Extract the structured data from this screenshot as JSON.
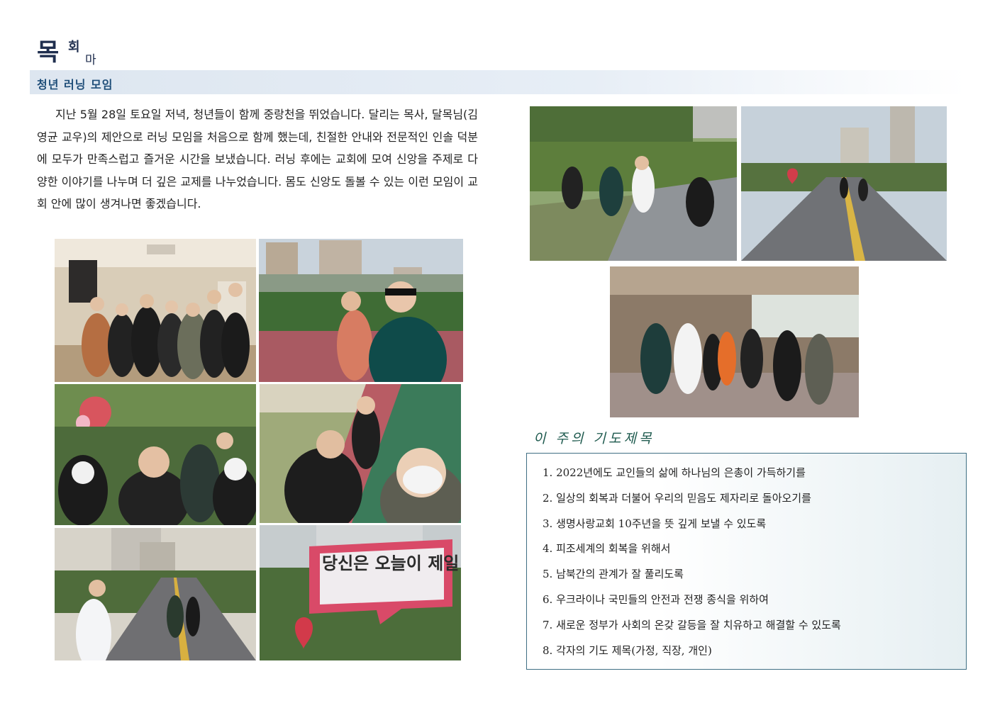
{
  "header": {
    "logo_main": "목",
    "logo_mid": "회",
    "logo_small": "마당",
    "section_title": "청년 러닝 모임"
  },
  "article": {
    "body": "지난 5월 28일 토요일 저녁, 청년들이 함께 중랑천을 뛰었습니다. 달리는 목사, 달목님(김영균 교우)의 제안으로 러닝 모임을 처음으로 함께 했는데, 친절한 안내와 전문적인 인솔 덕분에 모두가 만족스럽고 즐거운 시간을 보냈습니다. 러닝 후에는 교회에 모여 신앙을 주제로 다양한 이야기를 나누며 더 깊은 교제를 나누었습니다. 몸도 신앙도 돌볼 수 있는 이런 모임이 교회 안에 많이 생겨나면 좋겠습니다."
  },
  "photos": {
    "sign_text": "당신은 오늘이 제일 예쁘다"
  },
  "prayer": {
    "title": "이 주의 기도제목",
    "items": [
      "1. 2022년에도 교인들의 삶에 하나님의 은총이 가득하기를",
      "2. 일상의 회복과 더불어 우리의 믿음도 제자리로 돌아오기를",
      "3. 생명사랑교회 10주년을 뜻 깊게 보낼 수 있도록",
      "4. 피조세계의 회복을 위해서",
      "5. 남북간의 관계가 잘 풀리도록",
      "6. 우크라이나 국민들의 안전과 전쟁 종식을 위하여",
      "7. 새로운 정부가 사회의 온갖 갈등을 잘 치유하고 해결할 수 있도록",
      "8. 각자의 기도 제목(가정, 직장, 개인)"
    ]
  }
}
